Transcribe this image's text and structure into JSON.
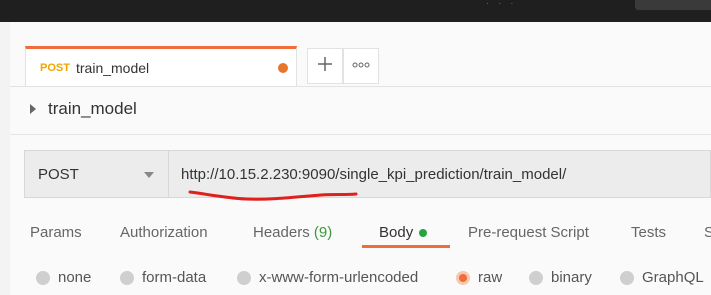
{
  "tab": {
    "method": "POST",
    "name": "train_model"
  },
  "request": {
    "name": "train_model",
    "method": "POST",
    "url": "http://10.15.2.230:9090/single_kpi_prediction/train_model/"
  },
  "subtabs": {
    "params": "Params",
    "authorization": "Authorization",
    "headers": "Headers",
    "headers_count": "(9)",
    "body": "Body",
    "prerequest": "Pre-request Script",
    "tests": "Tests",
    "more": "S"
  },
  "body_modes": [
    "none",
    "form-data",
    "x-www-form-urlencoded",
    "raw",
    "binary",
    "GraphQL"
  ],
  "selected_body_mode": "raw",
  "colors": {
    "accent": "#f26b3a",
    "post": "#f0a500",
    "body_dot": "#27a342",
    "annotation": "#e0201c"
  },
  "icons": {
    "add_tab": "plus-icon",
    "tab_options": "more-icon"
  }
}
